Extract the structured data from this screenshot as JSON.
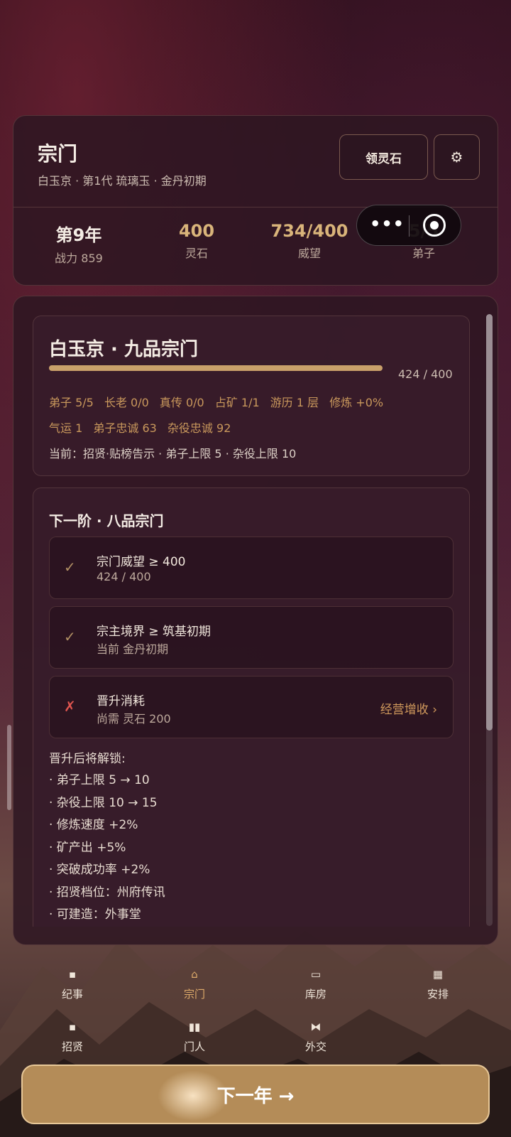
{
  "header": {
    "title": "宗门",
    "subtitle": "白玉京 · 第1代 琉璃玉 · 金丹初期",
    "collect_button": "领灵石",
    "settings_icon": "⚙",
    "stats": [
      {
        "value": "第9年",
        "label": "战力 859"
      },
      {
        "value": "400",
        "label": "灵石"
      },
      {
        "value": "734/400",
        "label": "威望"
      },
      {
        "value": "5/5",
        "label": "弟子"
      }
    ]
  },
  "capsule": {
    "more_icon": "•••"
  },
  "sect_card": {
    "title": "白玉京 · 九品宗门",
    "progress_label": "424 / 400",
    "progress_fraction": 1.0,
    "stats_line1": [
      "弟子 5/5",
      "长老 0/0",
      "真传 0/0",
      "占矿 1/1",
      "游历 1 层",
      "修炼 +0%"
    ],
    "stats_line2": [
      "气运 1",
      "弟子忠诚 63",
      "杂役忠诚 92"
    ],
    "current": "当前：招贤·贴榜告示 · 弟子上限 5 · 杂役上限 10"
  },
  "next_tier": {
    "title": "下一阶 · 八品宗门",
    "requirements": [
      {
        "mark": "✓",
        "title": "宗门威望 ≥ 400",
        "detail": "424 / 400",
        "met": true
      },
      {
        "mark": "✓",
        "title": "宗主境界 ≥ 筑基初期",
        "detail": "当前 金丹初期",
        "met": true
      },
      {
        "mark": "✗",
        "title": "晋升消耗",
        "detail": "尚需 灵石 200",
        "met": false,
        "link": "经营增收 ›"
      }
    ],
    "unlock_title": "晋升后将解锁:",
    "unlocks": [
      "· 弟子上限 5 → 10",
      "· 杂役上限 10 → 15",
      "· 修炼速度 +2%",
      "· 矿产出 +5%",
      "· 突破成功率 +2%",
      "· 招贤档位：州府传讯",
      "· 可建造：外事堂"
    ]
  },
  "nav": {
    "items": [
      {
        "label": "纪事",
        "icon": "scroll-icon",
        "glyph": "▪"
      },
      {
        "label": "宗门",
        "icon": "gate-icon",
        "glyph": "⌂"
      },
      {
        "label": "库房",
        "icon": "chest-icon",
        "glyph": "▭"
      },
      {
        "label": "安排",
        "icon": "grid-icon",
        "glyph": "▦"
      },
      {
        "label": "招贤",
        "icon": "scroll-icon",
        "glyph": "▪"
      },
      {
        "label": "门人",
        "icon": "people-icon",
        "glyph": "▮▮"
      },
      {
        "label": "外交",
        "icon": "handshake-icon",
        "glyph": "⧓"
      }
    ],
    "active": "宗门"
  },
  "next_year_button": "下一年 →",
  "colors": {
    "accent": "#c9a06a",
    "gold_text": "#c9985c",
    "error": "#e0554f",
    "button": "#b48c58"
  }
}
